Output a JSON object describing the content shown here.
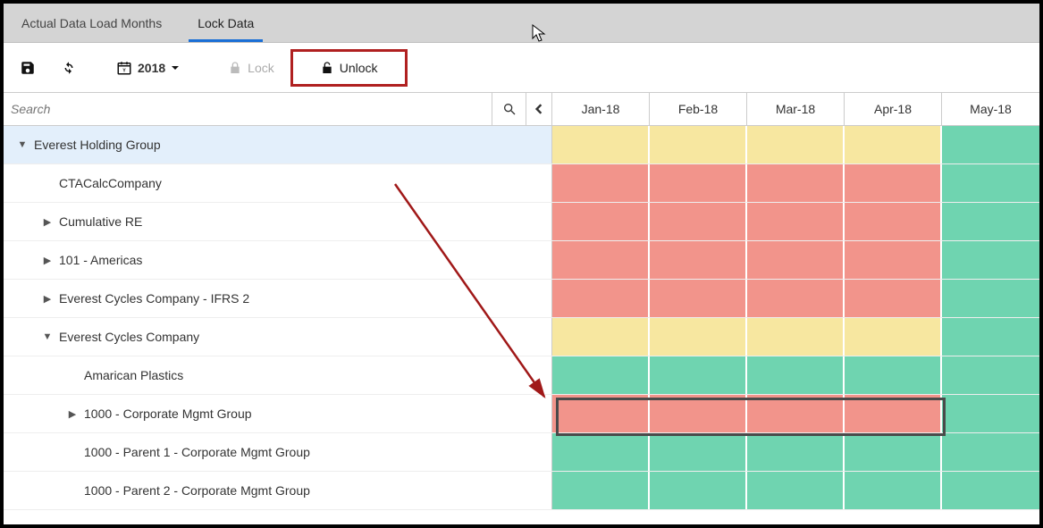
{
  "tabs": [
    {
      "label": "Actual Data Load Months",
      "active": false
    },
    {
      "label": "Lock Data",
      "active": true
    }
  ],
  "toolbar": {
    "year": "2018",
    "lock_label": "Lock",
    "unlock_label": "Unlock"
  },
  "search": {
    "placeholder": "Search"
  },
  "months": [
    "Jan-18",
    "Feb-18",
    "Mar-18",
    "Apr-18",
    "May-18"
  ],
  "colors": {
    "locked_partial": "#f7e7a0",
    "locked": "#f2948b",
    "unlocked": "#6fd4b0",
    "highlight": "#b02020"
  },
  "rows": [
    {
      "label": "Everest Holding Group",
      "indent": 0,
      "expander": "down",
      "selected": true,
      "cells": [
        "yellow",
        "yellow",
        "yellow",
        "yellow",
        "green"
      ]
    },
    {
      "label": "CTACalcCompany",
      "indent": 1,
      "expander": "none",
      "cells": [
        "red",
        "red",
        "red",
        "red",
        "green"
      ]
    },
    {
      "label": "Cumulative RE",
      "indent": 1,
      "expander": "right",
      "cells": [
        "red",
        "red",
        "red",
        "red",
        "green"
      ]
    },
    {
      "label": "101 - Americas",
      "indent": 1,
      "expander": "right",
      "cells": [
        "red",
        "red",
        "red",
        "red",
        "green"
      ]
    },
    {
      "label": "Everest Cycles Company - IFRS 2",
      "indent": 1,
      "expander": "right",
      "cells": [
        "red",
        "red",
        "red",
        "red",
        "green"
      ]
    },
    {
      "label": "Everest Cycles Company",
      "indent": 1,
      "expander": "down",
      "cells": [
        "yellow",
        "yellow",
        "yellow",
        "yellow",
        "green"
      ]
    },
    {
      "label": "Amarican Plastics",
      "indent": 2,
      "expander": "none",
      "cells": [
        "green",
        "green",
        "green",
        "green",
        "green"
      ]
    },
    {
      "label": "1000 - Corporate Mgmt Group",
      "indent": 2,
      "expander": "right",
      "cells": [
        "red",
        "red",
        "red",
        "red",
        "green"
      ],
      "boxed": true
    },
    {
      "label": "1000 - Parent 1 - Corporate Mgmt Group",
      "indent": 2,
      "expander": "none",
      "cells": [
        "green",
        "green",
        "green",
        "green",
        "green"
      ]
    },
    {
      "label": "1000 - Parent 2 - Corporate Mgmt Group",
      "indent": 2,
      "expander": "none",
      "cells": [
        "green",
        "green",
        "green",
        "green",
        "green"
      ]
    }
  ],
  "icons": {
    "save": "save-icon",
    "refresh": "refresh-icon",
    "calendar": "calendar-icon",
    "dropdown": "chevron-down-icon",
    "lock_closed": "lock-closed-icon",
    "lock_open": "lock-open-icon",
    "search": "search-icon",
    "nav_left": "chevron-left-icon"
  }
}
